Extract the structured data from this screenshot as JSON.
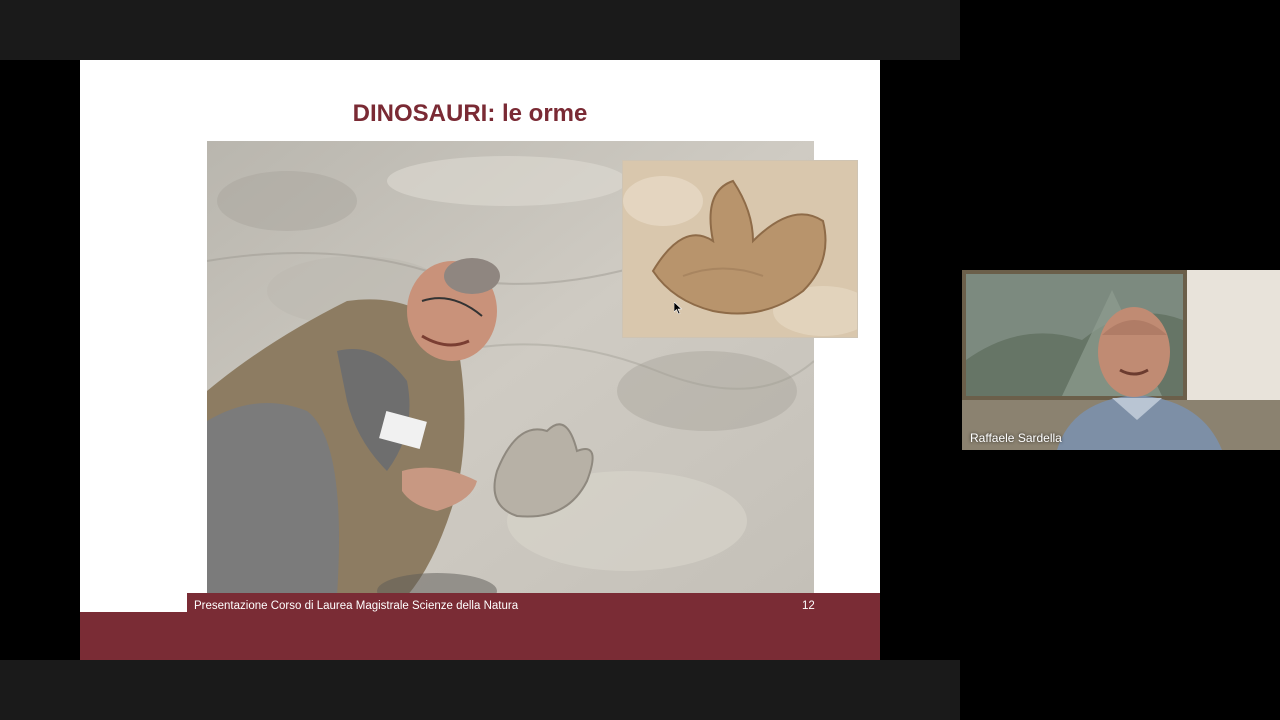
{
  "slide": {
    "title": "DINOSAURI: le orme",
    "footer_text": "Presentazione Corso di Laurea Magistrale Scienze della Natura",
    "page_number": "12",
    "main_photo": "person lying next to dinosaur footprint on rock",
    "inset_photo": "close-up of three-toed dinosaur footprint"
  },
  "participant": {
    "name": "Raffaele Sardella"
  },
  "colors": {
    "title": "#7a2a34",
    "footer_band": "#7a2c35",
    "background": "#000000"
  }
}
